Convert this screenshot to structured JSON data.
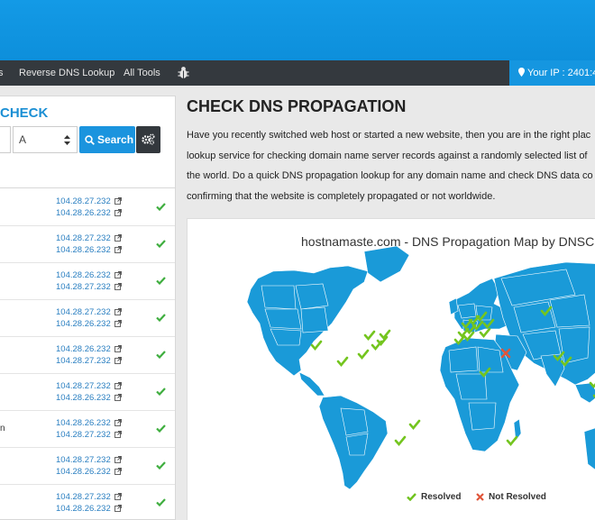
{
  "nav": {
    "items": [
      "s",
      "Reverse DNS Lookup",
      "All Tools"
    ],
    "ip_text": "Your IP : 2401:4"
  },
  "left": {
    "title": "CHECK",
    "record_type": "A",
    "search_label": "Search"
  },
  "results": [
    {
      "name": "",
      "ip1": "104.28.27.232",
      "ip2": "104.28.26.232"
    },
    {
      "name": "",
      "ip1": "104.28.27.232",
      "ip2": "104.28.26.232"
    },
    {
      "name": "",
      "ip1": "104.28.26.232",
      "ip2": "104.28.27.232"
    },
    {
      "name": "",
      "ip1": "104.28.27.232",
      "ip2": "104.28.26.232"
    },
    {
      "name": "",
      "ip1": "104.28.26.232",
      "ip2": "104.28.27.232"
    },
    {
      "name": "",
      "ip1": "104.28.27.232",
      "ip2": "104.28.26.232"
    },
    {
      "name": "n",
      "ip1": "104.28.26.232",
      "ip2": "104.28.27.232"
    },
    {
      "name": "",
      "ip1": "104.28.27.232",
      "ip2": "104.28.26.232"
    },
    {
      "name": "",
      "ip1": "104.28.27.232",
      "ip2": "104.28.26.232"
    }
  ],
  "main": {
    "title": "CHECK DNS PROPAGATION",
    "desc_lines": [
      "Have you recently switched web host or started a new website, then you are in the right plac",
      "lookup service for checking domain name server records against a randomly selected list of",
      "the world. Do a quick DNS propagation lookup for any domain name and check DNS data co",
      "confirming that the website is completely propagated or not worldwide."
    ],
    "map_title": "hostnamaste.com - DNS Propagation Map by DNSC",
    "legend_resolved": "Resolved",
    "legend_not_resolved": "Not Resolved"
  },
  "colors": {
    "accent": "#1b94de",
    "nav_bg": "#34393e",
    "map_land": "#1a9ad8",
    "resolved": "#6fc21d",
    "not_resolved": "#e0553a"
  }
}
